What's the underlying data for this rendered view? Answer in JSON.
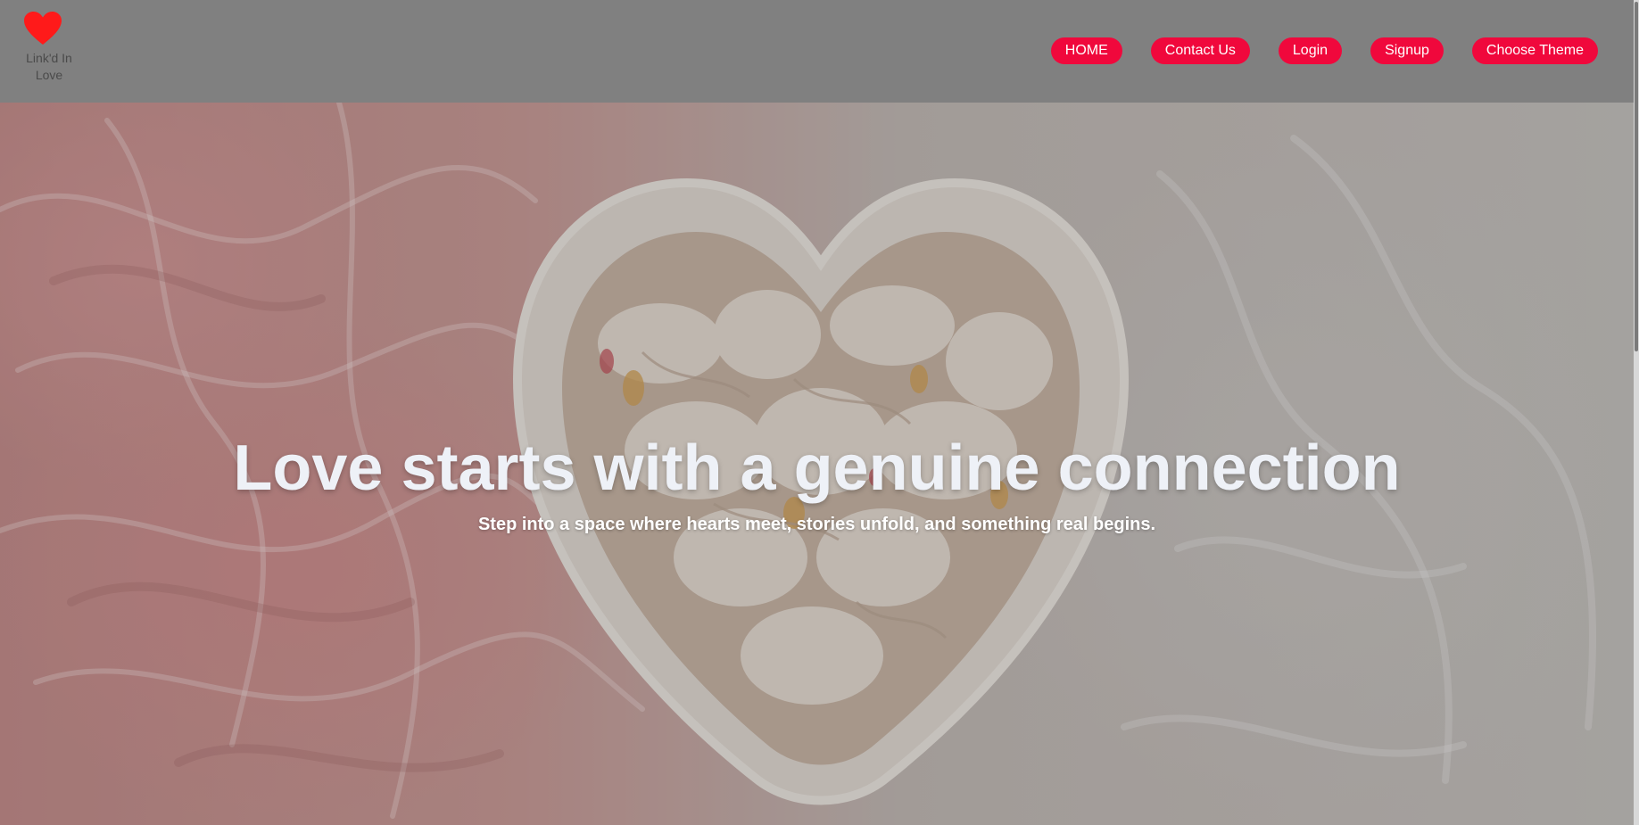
{
  "brand": {
    "name": "Link'd In Love",
    "icon": "heart-icon",
    "color": "#ff1a1a"
  },
  "nav": {
    "items": [
      {
        "label": "HOME"
      },
      {
        "label": "Contact Us"
      },
      {
        "label": "Login"
      },
      {
        "label": "Signup"
      },
      {
        "label": "Choose Theme"
      }
    ],
    "button_color": "#f0083c"
  },
  "hero": {
    "title": "Love starts with a genuine connection",
    "subtitle": "Step into a space where hearts meet, stories unfold, and something real begins.",
    "background_image": "heart-bowl-with-petals-on-pink-gauze"
  }
}
